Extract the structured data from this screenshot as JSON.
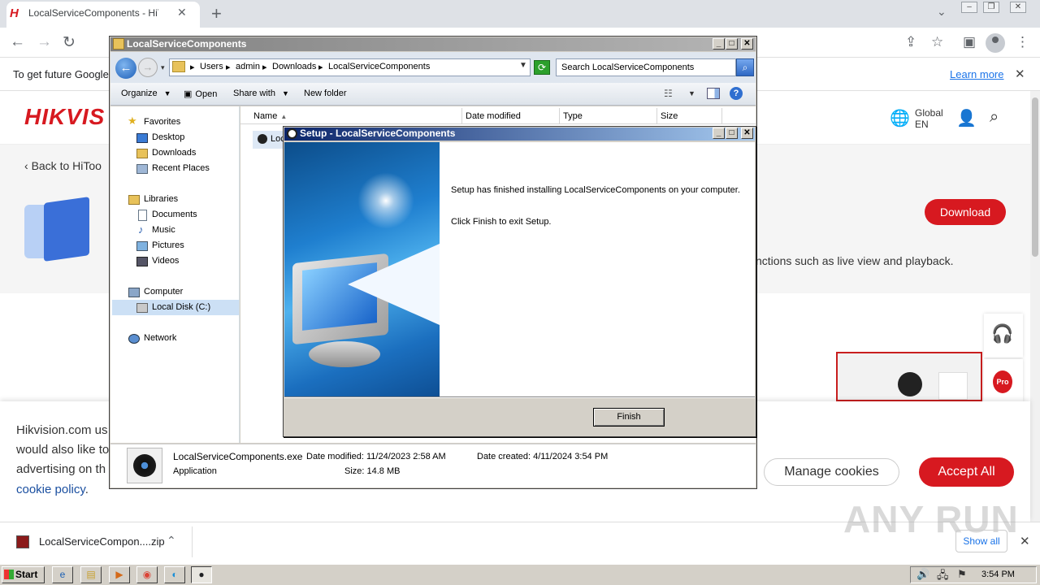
{
  "browser": {
    "tab_title": "LocalServiceComponents - HiTools - H",
    "tab_favicon": "H",
    "new_tab": "+",
    "tab_close": "✕",
    "infobar_text": "To get future Google",
    "learn_more": "Learn more",
    "infobar_close": "✕"
  },
  "site": {
    "logo": "HIKVIS",
    "region_line1": "Global",
    "region_line2": "EN",
    "back_link": "Back to HiToo",
    "desc_fragment": "nctions such as live view and playback.",
    "download_label": "Download",
    "pro_badge": "Pro",
    "accent_color": "#d71920"
  },
  "cookie": {
    "line1": "Hikvision.com us",
    "line2": "would also like to",
    "line3": "advertising on th",
    "policy_link": "cookie policy",
    "policy_end": ".",
    "manage_label": "Manage cookies",
    "accept_label": "Accept All"
  },
  "downloads": {
    "file_name": "LocalServiceCompon....zip",
    "show_all": "Show all",
    "watermark": "ANY RUN"
  },
  "taskbar": {
    "start_label": "Start",
    "clock": "3:54 PM"
  },
  "explorer": {
    "title": "LocalServiceComponents",
    "breadcrumb": [
      "Users",
      "admin",
      "Downloads",
      "LocalServiceComponents"
    ],
    "search_placeholder": "Search LocalServiceComponents",
    "commands": {
      "organize": "Organize",
      "open": "Open",
      "share_with": "Share with",
      "new_folder": "New folder"
    },
    "nav": {
      "favorites": "Favorites",
      "desktop": "Desktop",
      "downloads": "Downloads",
      "recent_places": "Recent Places",
      "libraries": "Libraries",
      "documents": "Documents",
      "music": "Music",
      "pictures": "Pictures",
      "videos": "Videos",
      "computer": "Computer",
      "local_disk": "Local Disk (C:)",
      "network": "Network"
    },
    "columns": {
      "name": "Name",
      "date_modified": "Date modified",
      "type": "Type",
      "size": "Size"
    },
    "file_row_text": "Loc",
    "details": {
      "filename": "LocalServiceComponents.exe",
      "type": "Application",
      "date_modified": "Date modified: 11/24/2023 2:58 AM",
      "size": "Size: 14.8 MB",
      "date_created": "Date created: 4/11/2024 3:54 PM"
    }
  },
  "setup": {
    "title": "Setup - LocalServiceComponents",
    "message1": "Setup has finished installing LocalServiceComponents on your computer.",
    "message2": "Click Finish to exit Setup.",
    "finish_label": "Finish"
  }
}
